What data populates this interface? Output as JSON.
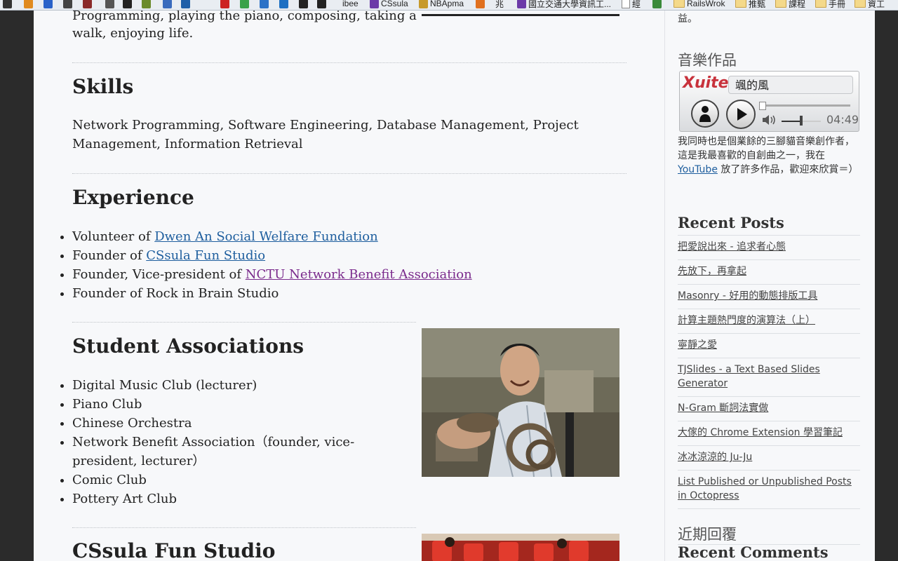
{
  "bookmarks": [
    {
      "label": "",
      "icon": "ninja-icon",
      "color": "#333"
    },
    {
      "label": "",
      "icon": "fox-icon",
      "color": "#e08a1e"
    },
    {
      "label": "",
      "icon": "b-icon",
      "color": "#2a62c9"
    },
    {
      "label": "",
      "icon": "jtv-icon",
      "color": "#444"
    },
    {
      "label": "",
      "icon": "cup-icon",
      "color": "#8a2a2a"
    },
    {
      "label": "",
      "icon": "p-icon",
      "color": "#555"
    },
    {
      "label": "",
      "icon": "sv-icon",
      "color": "#222"
    },
    {
      "label": "",
      "icon": "dp-icon",
      "color": "#6a8a2a"
    },
    {
      "label": "",
      "icon": "w-icon",
      "color": "#3a6bbd"
    },
    {
      "label": "",
      "icon": "it-icon",
      "color": "#1f5fa8"
    },
    {
      "label": "",
      "icon": "c-icon",
      "color": "#cc2222"
    },
    {
      "label": "",
      "icon": "recycle-icon",
      "color": "#3aa14a"
    },
    {
      "label": "",
      "icon": "w3-icon",
      "color": "#2c72c7"
    },
    {
      "label": "",
      "icon": "trello-icon",
      "color": "#1d6fc2"
    },
    {
      "label": "",
      "icon": "oh-icon",
      "color": "#222"
    },
    {
      "label": "",
      "icon": "r-icon",
      "color": "#222"
    },
    {
      "label": "ibee",
      "icon": "",
      "color": ""
    },
    {
      "label": "CSsula",
      "icon": "cssula-icon",
      "color": "#6b3aa8"
    },
    {
      "label": "NBApma",
      "icon": "nbapma-icon",
      "color": "#c79a2a"
    },
    {
      "label": "",
      "icon": "chart-icon",
      "color": "#e0701e"
    },
    {
      "label": "兆",
      "icon": "",
      "color": ""
    },
    {
      "label": "國立交通大學資訊工...",
      "icon": "nctu-icon",
      "color": "#6b3aa8"
    },
    {
      "label": "經",
      "icon": "doc-icon",
      "color": ""
    },
    {
      "label": "",
      "icon": "grid-icon",
      "color": "#3a8a3a"
    },
    {
      "label": "RailsWrok",
      "icon": "folder-icon",
      "color": ""
    },
    {
      "label": "推甄",
      "icon": "folder-icon",
      "color": ""
    },
    {
      "label": "課程",
      "icon": "folder-icon",
      "color": ""
    },
    {
      "label": "手冊",
      "icon": "folder-icon",
      "color": ""
    },
    {
      "label": "資工",
      "icon": "folder-icon",
      "color": ""
    }
  ],
  "main": {
    "intro_line1": "Programming, playing the piano, composing, taking a",
    "intro_line2": "walk, enjoying life.",
    "skills": {
      "heading": "Skills",
      "text": "Network Programming, Software Engineering, Database Management, Project Management, Information Retrieval"
    },
    "experience": {
      "heading": "Experience",
      "items": [
        {
          "prefix": "Volunteer of ",
          "link": "Dwen An Social Welfare Fundation",
          "visited": false
        },
        {
          "prefix": "Founder of ",
          "link": "CSsula Fun Studio",
          "visited": false
        },
        {
          "prefix": "Founder, Vice-president of ",
          "link": "NCTU Network Benefit Association",
          "visited": true
        },
        {
          "prefix": "Founder of Rock in Brain Studio",
          "link": "",
          "visited": false
        }
      ]
    },
    "associations": {
      "heading": "Student Associations",
      "items": [
        "Digital Music Club (lecturer)",
        "Piano Club",
        "Chinese Orchestra",
        "Network Benefit Association（founder, vice-president, lecturer）",
        "Comic Club",
        "Pottery Art Club"
      ]
    },
    "studio": {
      "heading": "CSsula Fun Studio"
    }
  },
  "sidebar": {
    "top_fragment": "益。",
    "music": {
      "heading": "音樂作品",
      "player": {
        "logo": "Xuite",
        "title": "颯的風",
        "time": "04:49",
        "progress": 0.0,
        "volume": 0.5
      },
      "desc_pre": "我同時也是個業餘的三腳貓音樂創作者，這是我最喜歡的自創曲之一，我在",
      "desc_link": "YouTube",
      "desc_post": "放了許多作品，歡迎來欣賞＝）"
    },
    "recent_posts": {
      "heading": "Recent Posts",
      "items": [
        "把愛說出來 - 追求者心態",
        "先放下，再拿起",
        "Masonry - 好用的動態排版工具",
        "計算主題熱門度的演算法（上）",
        "寧靜之愛",
        "TJSlides - a Text Based Slides Generator",
        "N-Gram 斷詞法實做",
        "大傢的 Chrome Extension 學習筆記",
        "冰冰涼涼的 Ju-Ju",
        "List Published or Unpublished Posts in Octopress"
      ]
    },
    "comments": {
      "heading_cjk": "近期回覆",
      "heading": "Recent Comments"
    }
  }
}
